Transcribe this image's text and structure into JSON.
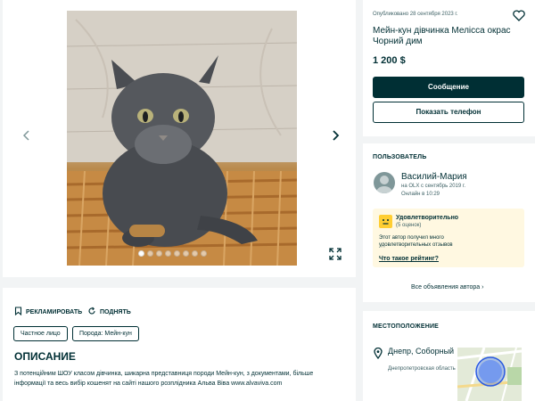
{
  "listing": {
    "published": "Опубликовано 28 сентября 2023 г.",
    "title": "Мейн-кун дівчинка Мелісса окрас Чорний дим",
    "price": "1 200 $",
    "message_button": "Сообщение",
    "phone_button": "Показать телефон"
  },
  "gallery": {
    "image_count": 8,
    "active_index": 0
  },
  "seller": {
    "section_title": "ПОЛЬЗОВАТЕЛЬ",
    "name": "Василий-Мария",
    "since": "на OLX с сентябрь 2019 г.",
    "online": "Онлайн в 10:29",
    "rating_title": "Удовлетворительно",
    "rating_count": "(5 оценок)",
    "rating_description": "Этот автор получил много удовлетворительных отзывов",
    "rating_link": "Что такое рейтинг?",
    "all_ads": "Все объявления автора"
  },
  "actions": {
    "promote": "РЕКЛАМИРОВАТЬ",
    "refresh": "ПОДНЯТЬ"
  },
  "tags": [
    "Частное лицо",
    "Порода: Мейн-кун"
  ],
  "description": {
    "heading": "ОПИСАНИЕ",
    "text": "З потенційним ШОУ класом дівчинка, шикарна представниця породи Мейн-кун, з документами, більше інформації та весь вибір кошенят на сайті нашого розплідника Альва Віва www.alvaviva.com"
  },
  "location": {
    "section_title": "МЕСТОПОЛОЖЕНИЕ",
    "city": "Днепр, Соборный",
    "region": "Днепропетровская область"
  },
  "colors": {
    "primary": "#002f34",
    "background": "#f2f4f5",
    "rating_bg": "#fff8e1",
    "rating_face": "#ffce32"
  },
  "icons": [
    "chevron-left-icon",
    "chevron-right-icon",
    "expand-icon",
    "heart-icon",
    "bookmark-icon",
    "refresh-icon",
    "location-pin-icon"
  ]
}
